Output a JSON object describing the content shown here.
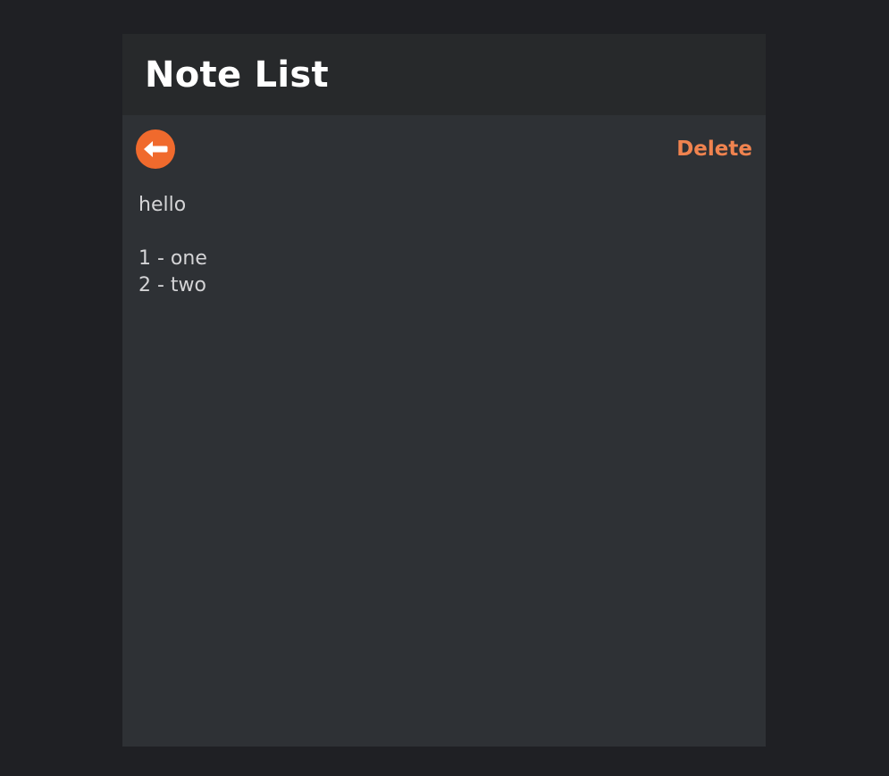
{
  "header": {
    "title": "Note List"
  },
  "toolbar": {
    "back_icon": "arrow-left-circle-icon",
    "delete_label": "Delete"
  },
  "note": {
    "content": "hello\n\n1 - one\n2 - two"
  },
  "colors": {
    "page_background": "#1f2024",
    "header_background": "#27292b",
    "panel_background": "#2e3135",
    "accent": "#f06a2d",
    "delete_text": "#f0834f",
    "body_text": "#d4d4d6"
  }
}
